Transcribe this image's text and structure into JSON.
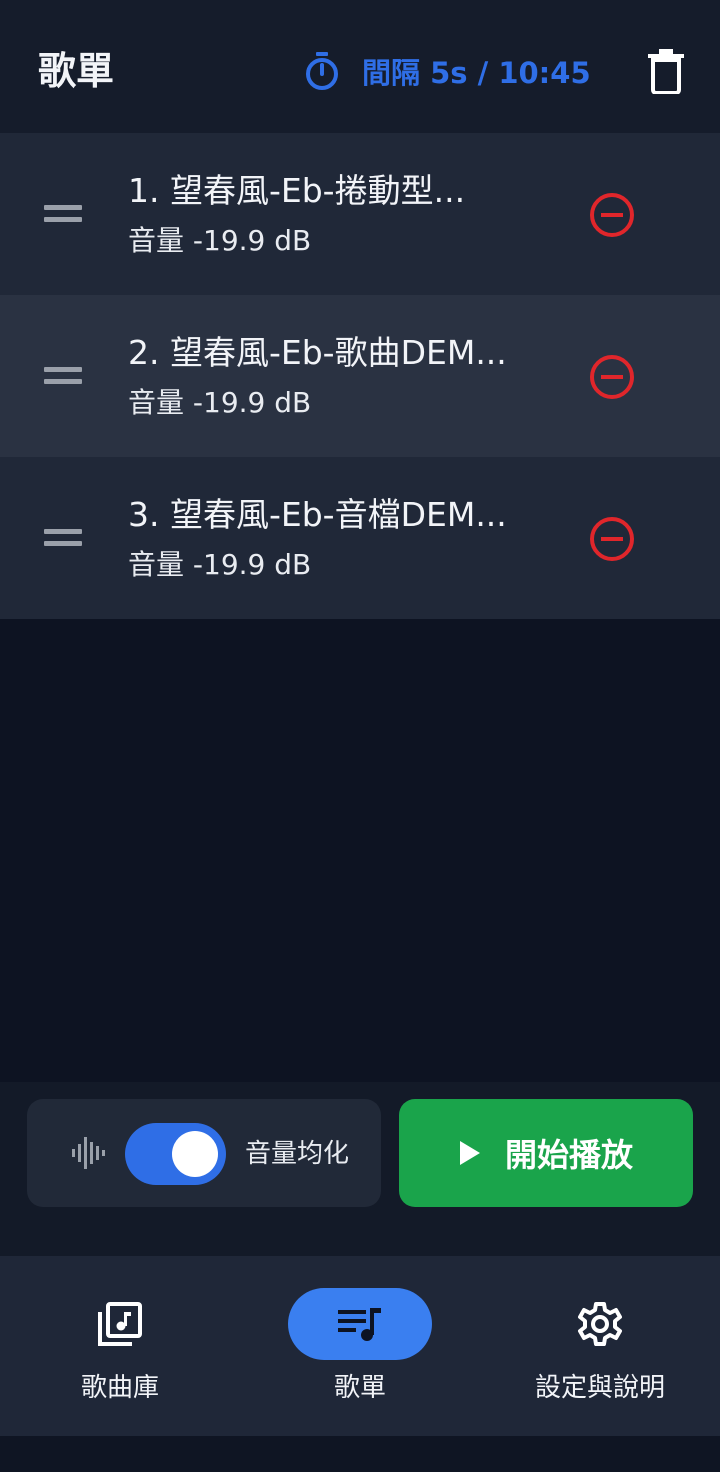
{
  "header": {
    "title": "歌單",
    "timer_text": "間隔 5s / 10:45",
    "icons": {
      "timer": "stopwatch-icon",
      "delete_all": "trash-icon"
    }
  },
  "playlist": {
    "items": [
      {
        "title": "1. 望春風-Eb-捲動型...",
        "volume": "音量 -19.9 dB"
      },
      {
        "title": "2. 望春風-Eb-歌曲DEM...",
        "volume": "音量 -19.9 dB"
      },
      {
        "title": "3. 望春風-Eb-音檔DEM...",
        "volume": "音量 -19.9 dB"
      }
    ]
  },
  "controls": {
    "normalize_label": "音量均化",
    "normalize_enabled": true,
    "play_label": "開始播放"
  },
  "bottom_nav": {
    "items": [
      {
        "label": "歌曲庫",
        "icon": "music-library-icon",
        "active": false
      },
      {
        "label": "歌單",
        "icon": "playlist-icon",
        "active": true
      },
      {
        "label": "設定與說明",
        "icon": "gear-icon",
        "active": false
      }
    ]
  },
  "colors": {
    "accent": "#2f6ee6",
    "nav_active": "#3a7ff0",
    "play_green": "#1aa44b",
    "remove_red": "#e0262b",
    "background": "#0d1322"
  }
}
